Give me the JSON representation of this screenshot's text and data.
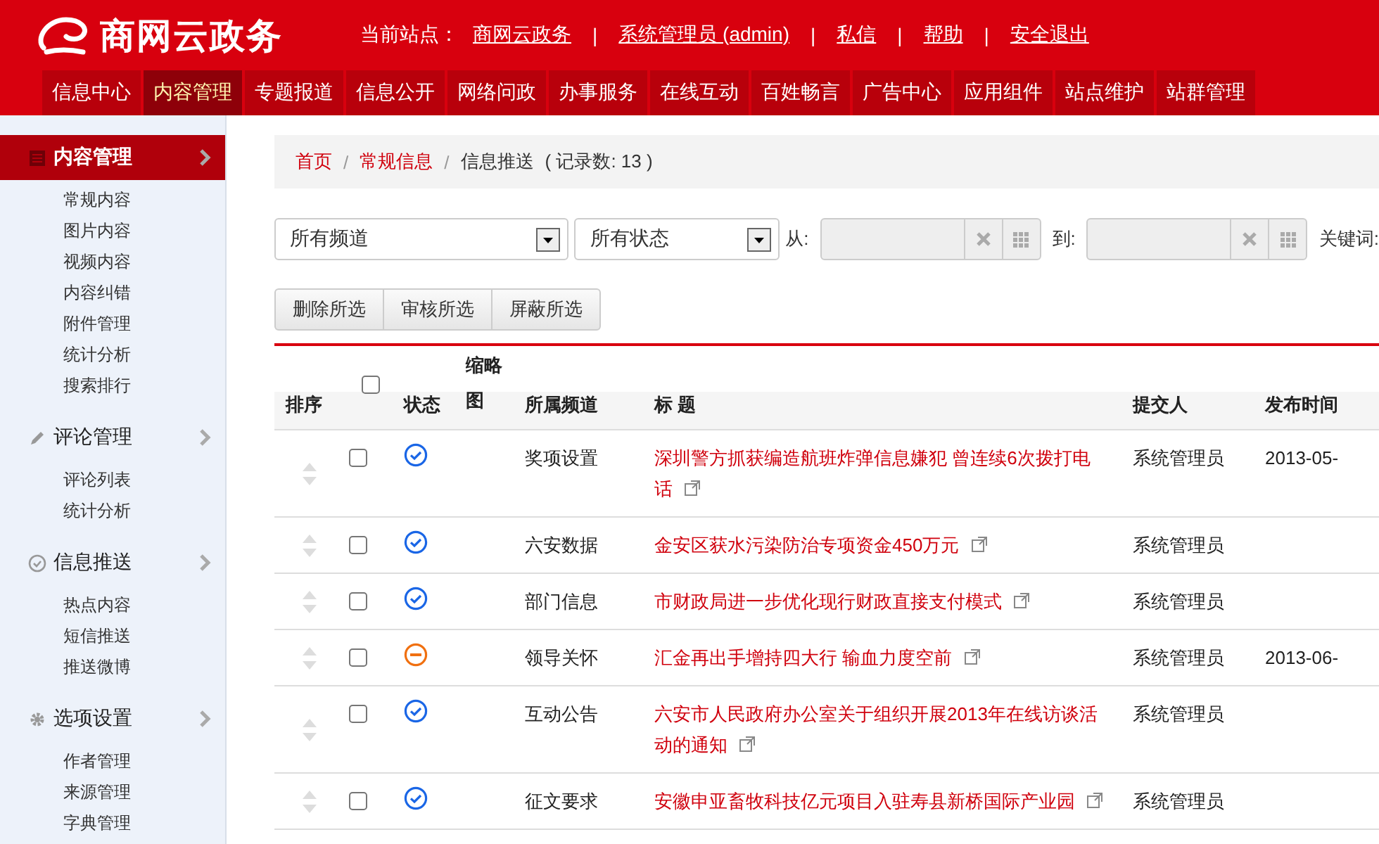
{
  "header": {
    "logo": "商网云政务",
    "site_label": "当前站点：",
    "links": [
      "商网云政务",
      "系统管理员 (admin)",
      "私信",
      "帮助",
      "安全退出"
    ],
    "separator": "|"
  },
  "nav": [
    {
      "label": "信息中心",
      "selected": false
    },
    {
      "label": "内容管理",
      "selected": true
    },
    {
      "label": "专题报道",
      "selected": false
    },
    {
      "label": "信息公开",
      "selected": false
    },
    {
      "label": "网络问政",
      "selected": false
    },
    {
      "label": "办事服务",
      "selected": false
    },
    {
      "label": "在线互动",
      "selected": false
    },
    {
      "label": "百姓畅言",
      "selected": false
    },
    {
      "label": "广告中心",
      "selected": false
    },
    {
      "label": "应用组件",
      "selected": false
    },
    {
      "label": "站点维护",
      "selected": false
    },
    {
      "label": "站群管理",
      "selected": false
    }
  ],
  "sidebar": [
    {
      "kind": "list",
      "label": "内容管理",
      "selected": true,
      "items": [
        "常规内容",
        "图片内容",
        "视频内容",
        "内容纠错",
        "附件管理",
        "统计分析",
        "搜索排行"
      ]
    },
    {
      "kind": "pencil",
      "label": "评论管理",
      "selected": false,
      "items": [
        "评论列表",
        "统计分析"
      ]
    },
    {
      "kind": "check",
      "label": "信息推送",
      "selected": false,
      "items": [
        "热点内容",
        "短信推送",
        "推送微博"
      ]
    },
    {
      "kind": "gear",
      "label": "选项设置",
      "selected": false,
      "items": [
        "作者管理",
        "来源管理",
        "字典管理"
      ]
    }
  ],
  "breadcrumb": {
    "links": [
      "首页",
      "常规信息"
    ],
    "separator": "/",
    "current": "信息推送",
    "count": "( 记录数: 13 )"
  },
  "filters": {
    "channel": "所有频道",
    "status": "所有状态",
    "from_label": "从:",
    "to_label": "到:",
    "keyword_label": "关键词:"
  },
  "actions": [
    "删除所选",
    "审核所选",
    "屏蔽所选"
  ],
  "table": {
    "select_all_checked": false,
    "columns": [
      "排序",
      "状态",
      "缩略图",
      "所属频道",
      "标 题",
      "提交人",
      "发布时间"
    ],
    "rows": [
      {
        "checked": false,
        "approved": true,
        "channel": "奖项设置",
        "title": "深圳警方抓获编造航班炸弹信息嫌犯 曾连续6次拨打电话",
        "submitter": "系统管理员",
        "date": "2013-05-"
      },
      {
        "checked": false,
        "approved": true,
        "channel": "六安数据",
        "title": "金安区获水污染防治专项资金450万元",
        "submitter": "系统管理员"
      },
      {
        "checked": false,
        "approved": true,
        "channel": "部门信息",
        "title": "市财政局进一步优化现行财政直接支付模式",
        "submitter": "系统管理员"
      },
      {
        "checked": false,
        "approved": false,
        "channel": "领导关怀",
        "title": "汇金再出手增持四大行 输血力度空前",
        "submitter": "系统管理员",
        "date": "2013-06-"
      },
      {
        "checked": false,
        "approved": true,
        "channel": "互动公告",
        "title": "六安市人民政府办公室关于组织开展2013年在线访谈活动的通知",
        "submitter": "系统管理员"
      },
      {
        "checked": false,
        "approved": true,
        "channel": "征文要求",
        "title": "安徽申亚畜牧科技亿元项目入驻寿县新桥国际产业园",
        "submitter": "系统管理员"
      }
    ]
  }
}
